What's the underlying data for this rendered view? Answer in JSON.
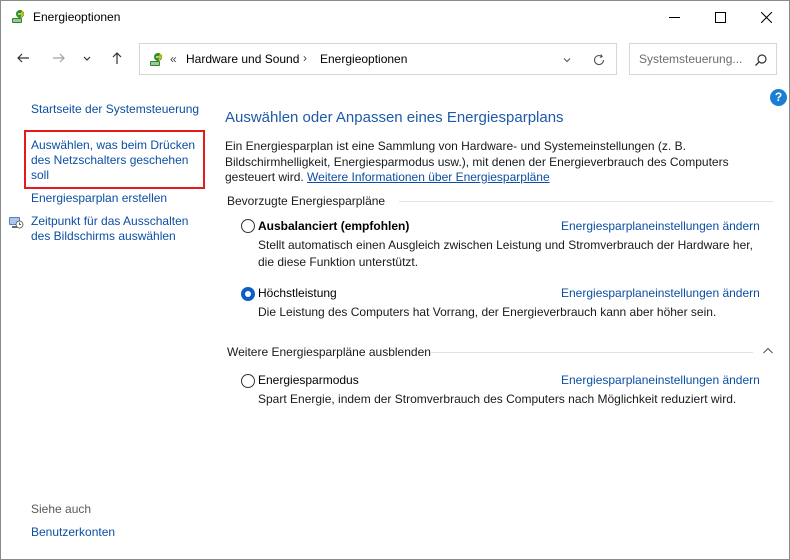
{
  "window": {
    "title": "Energieoptionen",
    "app_icon": "power-options-icon"
  },
  "navbar": {
    "addr_overflow": "«",
    "breadcrumb": [
      "Hardware und Sound",
      "Energieoptionen"
    ],
    "crumb_separator": "›",
    "search_placeholder": "Systemsteuerung..."
  },
  "help": {
    "label": "?"
  },
  "sidebar": {
    "home": "Startseite der Systemsteuerung",
    "power_button": "Auswählen, was beim Drücken des Netzschalters geschehen soll",
    "create_plan": "Energiesparplan erstellen",
    "display_off": "Zeitpunkt für das Ausschalten des Bildschirms auswählen",
    "see_also": "Siehe auch",
    "user_accounts": "Benutzerkonten"
  },
  "main": {
    "title": "Auswählen oder Anpassen eines Energiesparplans",
    "intro_text": "Ein Energiesparplan ist eine Sammlung von Hardware- und Systemeinstellungen (z. B. Bildschirmhelligkeit, Energiesparmodus usw.), mit denen der Energieverbrauch des Computers gesteuert wird. ",
    "intro_link": "Weitere Informationen über Energiesparpläne",
    "preferred_heading": "Bevorzugte Energiesparpläne",
    "more_heading": "Weitere Energiesparpläne ausblenden",
    "plans": [
      {
        "name": "Ausbalanciert (empfohlen)",
        "selected": false,
        "settings_link": "Energiesparplaneinstellungen ändern",
        "description": "Stellt automatisch einen Ausgleich zwischen Leistung und Stromverbrauch der Hardware her, die diese Funktion unterstützt."
      },
      {
        "name": "Höchstleistung",
        "selected": true,
        "settings_link": "Energiesparplaneinstellungen ändern",
        "description": "Die Leistung des Computers hat Vorrang, der Energieverbrauch kann aber höher sein."
      },
      {
        "name": "Energiesparmodus",
        "selected": false,
        "settings_link": "Energiesparplaneinstellungen ändern",
        "description": "Spart Energie, indem der Stromverbrauch des Computers nach Möglichkeit reduziert wird."
      }
    ]
  },
  "colors": {
    "link": "#0b4fa3",
    "title": "#1e5aa8",
    "highlight": "#e51a1a",
    "radio_selected": "#0c5fc4"
  }
}
